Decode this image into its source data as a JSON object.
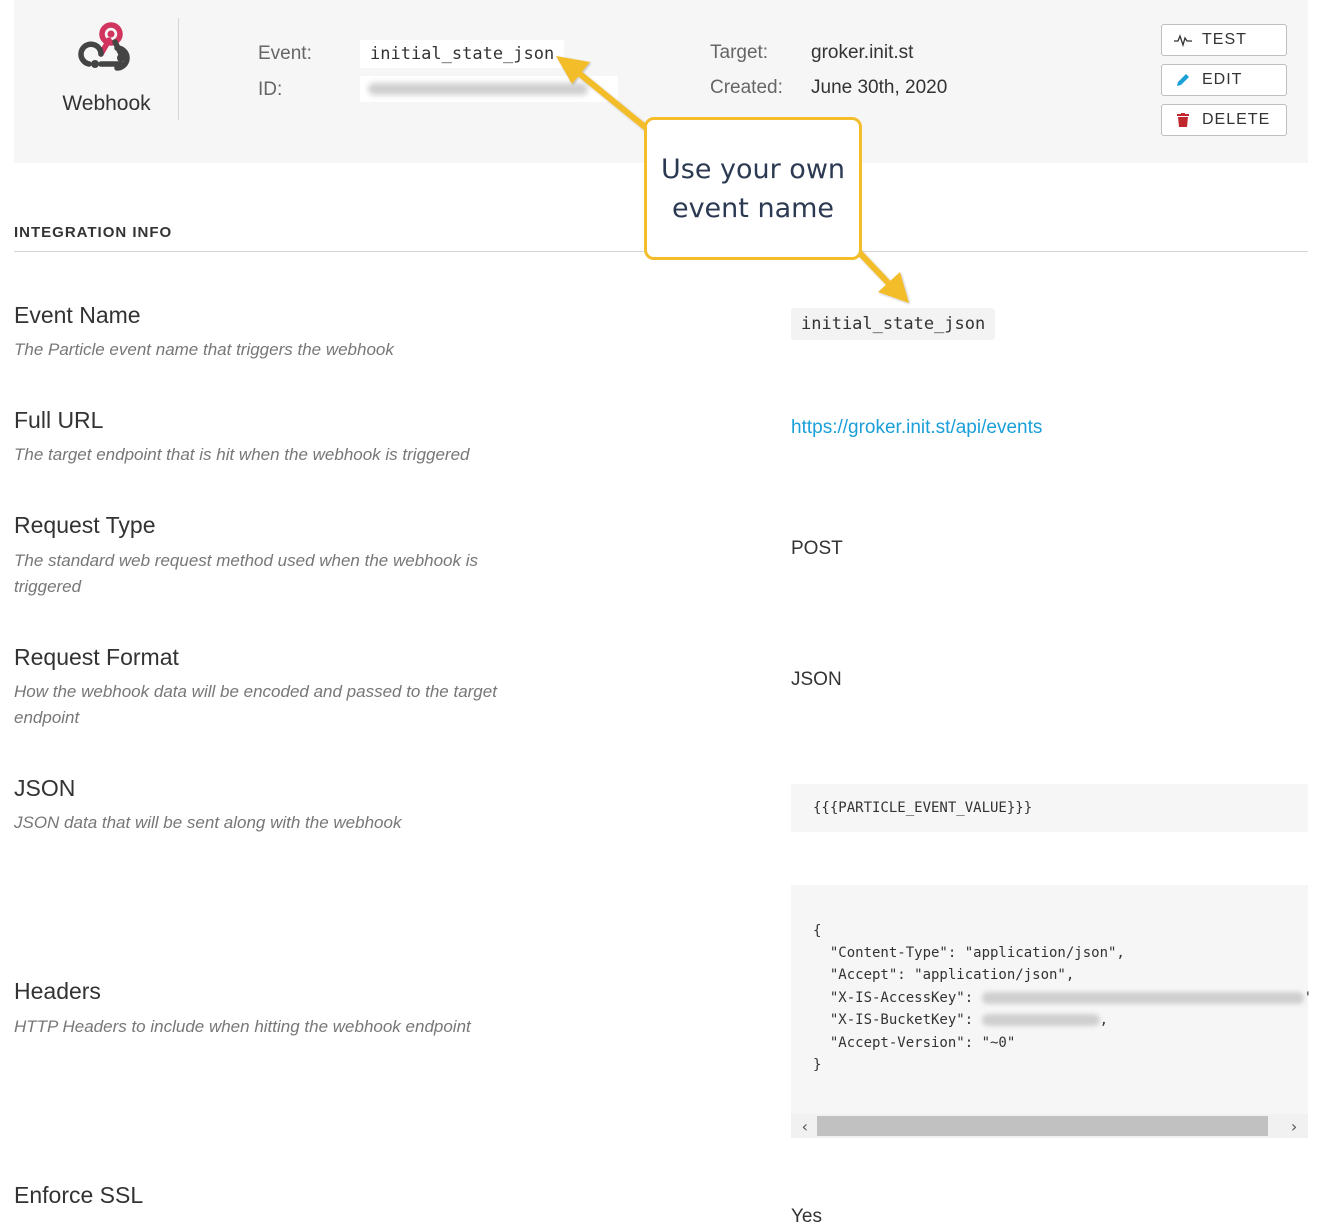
{
  "header": {
    "logo_label": "Webhook",
    "event_label": "Event:",
    "event_value": "initial_state_json",
    "id_label": "ID:",
    "target_label": "Target:",
    "target_value": "groker.init.st",
    "created_label": "Created:",
    "created_value": "June 30th, 2020",
    "buttons": {
      "test": "TEST",
      "edit": "EDIT",
      "delete": "DELETE"
    }
  },
  "callout": {
    "line1": "Use your own",
    "line2": "event name"
  },
  "section": {
    "title": "INTEGRATION INFO"
  },
  "rows": {
    "event_name": {
      "title": "Event Name",
      "desc": "The Particle event name that triggers the webhook",
      "value": "initial_state_json"
    },
    "full_url": {
      "title": "Full URL",
      "desc": "The target endpoint that is hit when the webhook is triggered",
      "value": "https://groker.init.st/api/events"
    },
    "request_type": {
      "title": "Request Type",
      "desc": "The standard web request method used when the webhook is triggered",
      "value": "POST"
    },
    "request_format": {
      "title": "Request Format",
      "desc": "How the webhook data will be encoded and passed to the target endpoint",
      "value": "JSON"
    },
    "json": {
      "title": "JSON",
      "desc": "JSON data that will be sent along with the webhook",
      "value": "{{{PARTICLE_EVENT_VALUE}}}"
    },
    "headers": {
      "title": "Headers",
      "desc": "HTTP Headers to include when hitting the webhook endpoint",
      "lines": [
        "{",
        "  \"Content-Type\": \"application/json\",",
        "  \"Accept\": \"application/json\",",
        "  \"X-IS-AccessKey\": ",
        "  \"X-IS-BucketKey\": ",
        "  \"Accept-Version\": \"~0\"",
        "}"
      ],
      "line4_tail": "'",
      "line5_tail": ","
    },
    "enforce_ssl": {
      "title": "Enforce SSL",
      "value": "Yes"
    }
  },
  "colors": {
    "accent_link": "#1a9fd9",
    "callout_border": "#f3bd2c",
    "delete_icon": "#c0282d",
    "edit_icon": "#1a9fd9",
    "logo_pink": "#d0345f"
  }
}
